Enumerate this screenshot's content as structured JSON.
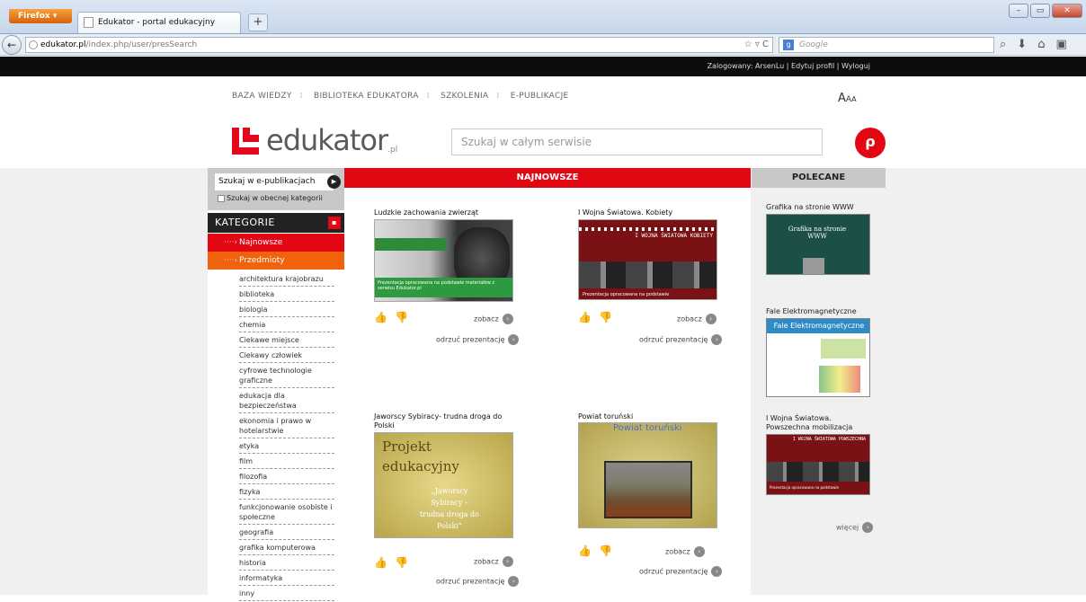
{
  "browser": {
    "firefox_label": "Firefox",
    "tab_title": "Edukator - portal edukacyjny",
    "new_tab": "+",
    "url_host": "edukator.pl",
    "url_path": "/index.php/user/presSearch",
    "search_placeholder": "Google"
  },
  "site": {
    "login_text": "Zalogowany: ArsenLu | Edytuj profil | Wyloguj",
    "nav": [
      "BAZA WIEDZY",
      "BIBLIOTEKA EDUKATORA",
      "SZKOLENIA",
      "E-PUBLIKACJE"
    ],
    "font_size_label": "AAA",
    "logo_text": "edukator",
    "logo_suffix": ".pl",
    "search_placeholder": "Szukaj w całym serwisie"
  },
  "sidebar": {
    "epub_search_button": "Szukaj w e-publikacjach",
    "current_category_checkbox": "Szukaj w obecnej kategorii",
    "categories_title": "KATEGORIE",
    "item_newest": "Najnowsze",
    "item_subjects": "Przedmioty",
    "subjects": [
      "architektura krajobrazu",
      "biblioteka",
      "biologia",
      "chemia",
      "Ciekawe miejsce",
      "Ciekawy człowiek",
      "cyfrowe technologie graficzne",
      "edukacja dla bezpieczeństwa",
      "ekonomia i prawo w hotelarstwie",
      "etyka",
      "film",
      "filozofia",
      "fizyka",
      "funkcjonowanie osobiste i społeczne",
      "geografia",
      "grafika komputerowa",
      "historia",
      "informatyka",
      "inny"
    ]
  },
  "main": {
    "header": "NAJNOWSZE",
    "see_label": "zobacz",
    "reject_label": "odrzuć prezentację",
    "cards": [
      {
        "title": "Ludzkie zachowania zwierząt",
        "thumb_text": "Prezentacja opracowana na podstawie materiałów z serwisu Edukator.pl"
      },
      {
        "title": "I Wojna Światowa. Kobiety",
        "thumb_heading": "I WOJNA ŚWIATOWA KOBIETY",
        "thumb_text": "Prezentacja opracowana na podstawie"
      },
      {
        "title": "Jaworscy Sybiracy- trudna droga do Polski",
        "thumb_heading": "Projekt edukacyjny",
        "thumb_text": "„Jaworscy Sybiracy – trudna droga do Polski”"
      },
      {
        "title": "Powiat toruński",
        "thumb_heading": "Powiat toruński"
      }
    ]
  },
  "recommended": {
    "header": "POLECANE",
    "items": [
      {
        "title": "Grafika na stronie WWW",
        "thumb_heading": "Grafika na stronie WWW"
      },
      {
        "title": "Fale Elektromagnetyczne",
        "thumb_heading": "Fale Elektromagnetyczne"
      },
      {
        "title": "I Wojna Światowa. Powszechna mobilizacja",
        "thumb_heading": "I WOJNA ŚWIATOWA POWSZECHNA",
        "thumb_text": "Prezentacja opracowana na podstawie"
      }
    ],
    "more_label": "więcej"
  },
  "colors": {
    "brand_red": "#e30613",
    "brand_orange": "#f0620c"
  }
}
